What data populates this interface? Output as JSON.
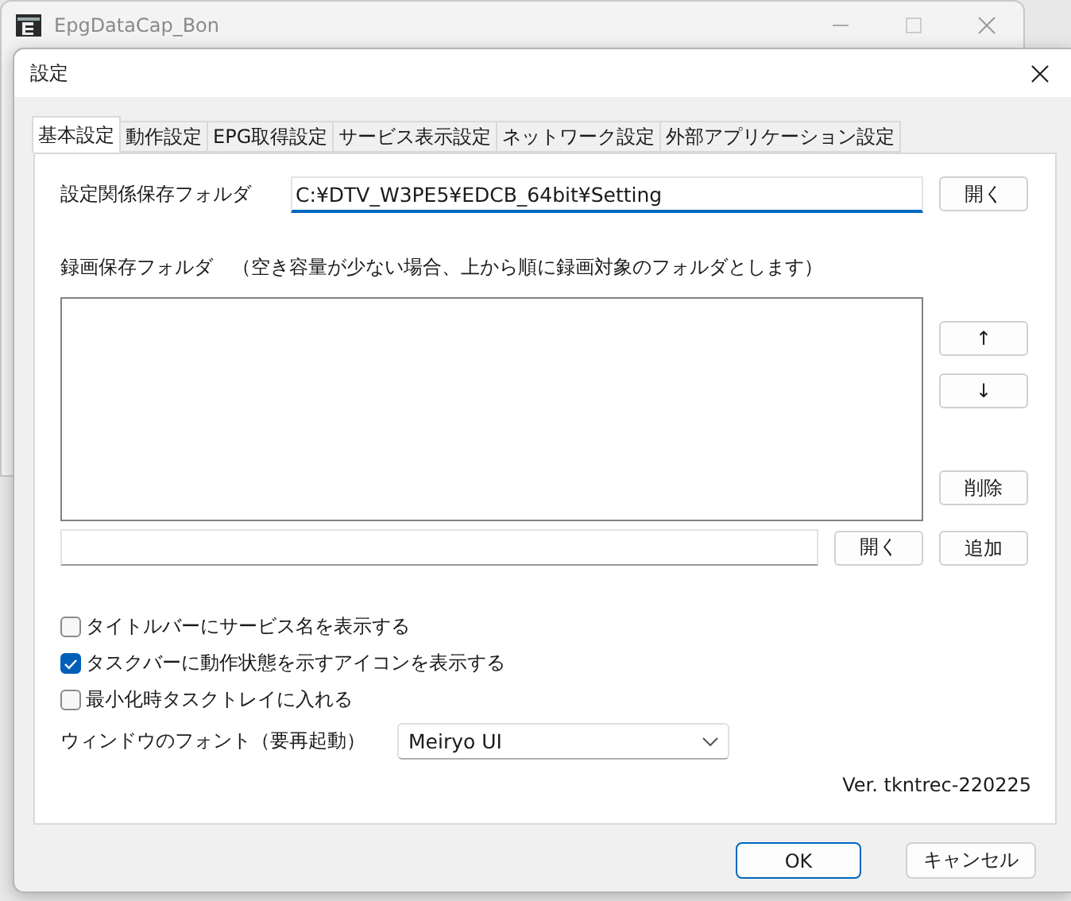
{
  "background_window": {
    "title": "EpgDataCap_Bon"
  },
  "dialog": {
    "title": "設定"
  },
  "tabs": [
    {
      "label": "基本設定",
      "selected": true
    },
    {
      "label": "動作設定",
      "selected": false
    },
    {
      "label": "EPG取得設定",
      "selected": false
    },
    {
      "label": "サービス表示設定",
      "selected": false
    },
    {
      "label": "ネットワーク設定",
      "selected": false
    },
    {
      "label": "外部アプリケーション設定",
      "selected": false
    }
  ],
  "settings_folder": {
    "label": "設定関係保存フォルダ",
    "value": "C:¥DTV_W3PE5¥EDCB_64bit¥Setting",
    "button": "開く"
  },
  "recording_folders": {
    "label": "録画保存フォルダ　（空き容量が少ない場合、上から順に録画対象のフォルダとします）",
    "up_button": "↑",
    "down_button": "↓",
    "delete_button": "削除",
    "browse_button": "開く",
    "add_button": "追加"
  },
  "checkboxes": [
    {
      "label": "タイトルバーにサービス名を表示する",
      "checked": false
    },
    {
      "label": "タスクバーに動作状態を示すアイコンを表示する",
      "checked": true
    },
    {
      "label": "最小化時タスクトレイに入れる",
      "checked": false
    }
  ],
  "font": {
    "label": "ウィンドウのフォント（要再起動）",
    "value": "Meiryo UI"
  },
  "version": "Ver. tkntrec-220225",
  "buttons": [
    {
      "label": "OK",
      "kind": "default"
    },
    {
      "label": "キャンセル",
      "kind": "normal"
    }
  ]
}
